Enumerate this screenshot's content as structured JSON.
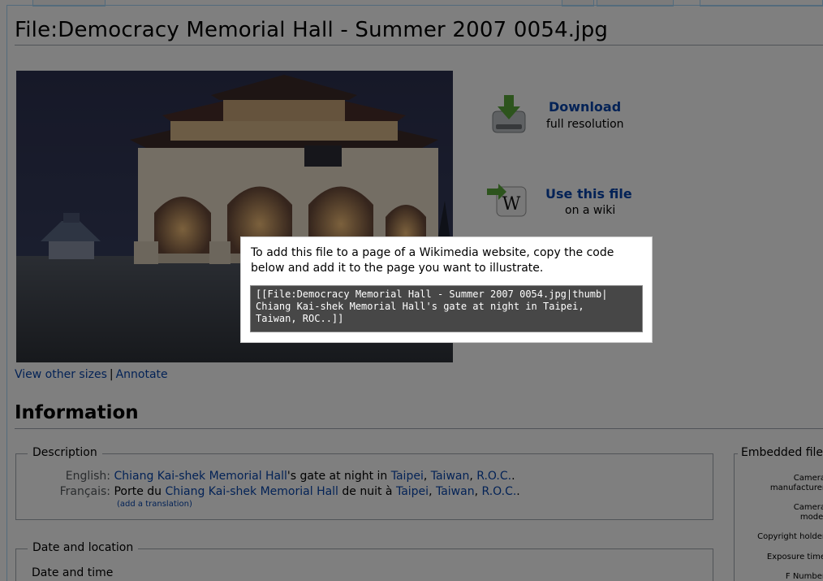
{
  "page": {
    "title": "File:Democracy Memorial Hall - Summer 2007 0054.jpg"
  },
  "image_links": {
    "other_sizes": "View other sizes",
    "separator": "|",
    "annotate": "Annotate"
  },
  "download": {
    "icon": "download-drive-icon",
    "title": "Download",
    "subtitle": "full resolution"
  },
  "use_file": {
    "icon": "wikipedia-w-icon",
    "title": "Use this file",
    "subtitle": "on a wiki"
  },
  "information": {
    "heading": "Information",
    "description": {
      "legend": "Description",
      "english": {
        "lang": "English:",
        "link1": "Chiang Kai-shek Memorial Hall",
        "text1": "'s gate at night in ",
        "link2": "Taipei",
        "comma1": ", ",
        "link3": "Taiwan",
        "comma2": ", ",
        "link4": "R.O.C.",
        "end": "."
      },
      "french": {
        "lang": "Français:",
        "text0": "Porte du ",
        "link1": "Chiang Kai-shek Memorial Hall",
        "text1": " de nuit à ",
        "link2": "Taipei",
        "comma1": ", ",
        "link3": "Taiwan",
        "comma2": ", ",
        "link4": "R.O.C.",
        "end": "."
      },
      "add_translation": "(add a translation)"
    },
    "date_location": {
      "legend": "Date and location",
      "date_time_label": "Date and time"
    },
    "embedded": {
      "legend": "Embedded file",
      "items": [
        "Camera manufacturer",
        "Camera model",
        "Copyright holder",
        "Exposure time",
        "F Number"
      ]
    }
  },
  "popup": {
    "instruction": "To add this file to a page of a Wikimedia website, copy the code below and add it to the page you want to illustrate.",
    "code": "[[File:Democracy Memorial Hall - Summer 2007 0054.jpg|thumb|\nChiang Kai-shek Memorial Hall's gate at night in Taipei,\nTaiwan, ROC..]]"
  },
  "colors": {
    "link": "#0645ad",
    "overlay": "rgba(0,0,0,0.5)",
    "code_bg": "#474747"
  }
}
